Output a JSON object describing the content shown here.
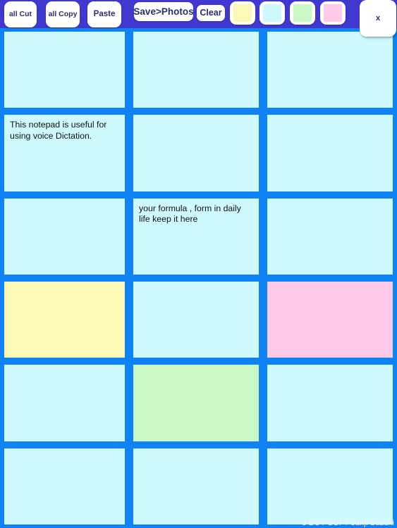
{
  "toolbar": {
    "cut_label": "all Cut",
    "copy_label": "all Copy",
    "paste_label": "Paste",
    "save_label": "Save>Photos",
    "clear_label": "Clear",
    "close_label": "x",
    "background_color": "#4139cf",
    "swatches": [
      {
        "name": "yellow",
        "color": "#fcf8b6"
      },
      {
        "name": "cyan",
        "color": "#cdf9ff"
      },
      {
        "name": "green",
        "color": "#caf8c6"
      },
      {
        "name": "pink",
        "color": "#ffc9e7"
      }
    ]
  },
  "grid": {
    "columns": 3,
    "rows": 6,
    "background_color": "#0f83f5",
    "default_cell_color": "#cdf9ff",
    "cells": [
      {
        "text": "",
        "color": "#cdf9ff"
      },
      {
        "text": "",
        "color": "#cdf9ff"
      },
      {
        "text": "",
        "color": "#cdf9ff"
      },
      {
        "text": "This notepad is useful for using voice Dictation.",
        "color": "#cdf9ff"
      },
      {
        "text": "",
        "color": "#cdf9ff"
      },
      {
        "text": "",
        "color": "#cdf9ff"
      },
      {
        "text": "",
        "color": "#cdf9ff"
      },
      {
        "text": "your formula , form in daily life keep it here",
        "color": "#cdf9ff"
      },
      {
        "text": "",
        "color": "#cdf9ff"
      },
      {
        "text": "",
        "color": "#fcf8b6"
      },
      {
        "text": "",
        "color": "#cdf9ff"
      },
      {
        "text": "",
        "color": "#ffc9e7"
      },
      {
        "text": "",
        "color": "#cdf9ff"
      },
      {
        "text": "",
        "color": "#caf8c6"
      },
      {
        "text": "",
        "color": "#cdf9ff"
      },
      {
        "text": "",
        "color": "#cdf9ff"
      },
      {
        "text": "",
        "color": "#cdf9ff"
      },
      {
        "text": "",
        "color": "#cdf9ff"
      }
    ]
  },
  "footer": {
    "credit": "J BOY SOFT  Junji Suzuki"
  }
}
